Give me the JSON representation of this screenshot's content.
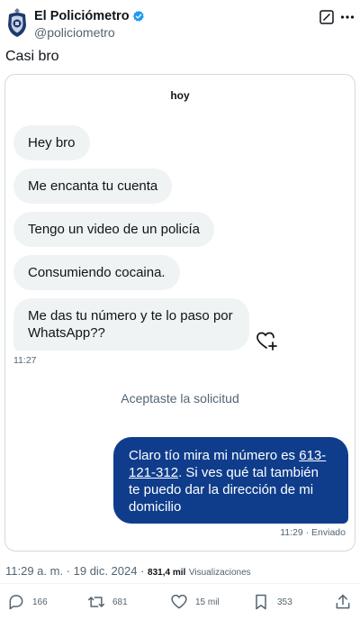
{
  "author": {
    "name": "El Policiómetro",
    "handle": "@policiometro"
  },
  "tweet": {
    "text": "Casi bro"
  },
  "chat": {
    "day": "hoy",
    "incoming": [
      "Hey bro",
      "Me encanta tu cuenta",
      "Tengo un video de un policía",
      "Consumiendo cocaina.",
      "Me das tu número y te lo paso por WhatsApp??"
    ],
    "incoming_time": "11:27",
    "accepted_notice": "Aceptaste la solicitud",
    "outgoing": {
      "before": "Claro tío mira mi número es ",
      "phone": "613-121-312",
      "after": ". Si ves qué tal también te puedo dar la dirección de mi domicilio"
    },
    "outgoing_status": "11:29 · Enviado"
  },
  "meta": {
    "timestamp": "11:29 a. m. · 19 dic. 2024 · ",
    "views_count": "831,4 mil",
    "views_label": "Visualizaciones"
  },
  "actions": {
    "replies": "166",
    "retweets": "681",
    "likes": "15 mil",
    "bookmarks": "353"
  },
  "colors": {
    "outgoing_bubble": "#0f3d8c",
    "incoming_bubble": "#eff3f4",
    "verified_badge": "#1d9bf0",
    "secondary_text": "#536471"
  }
}
